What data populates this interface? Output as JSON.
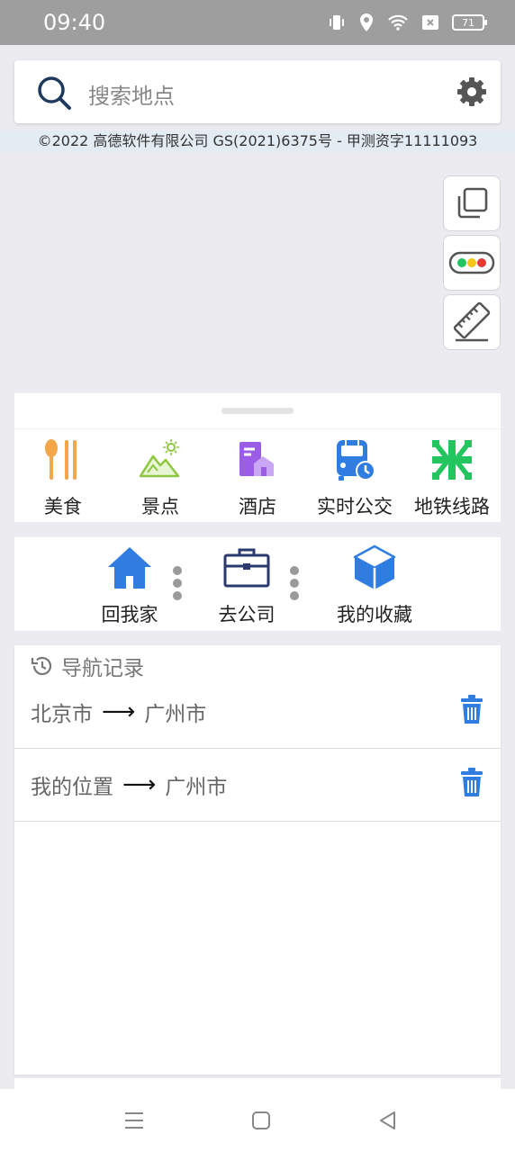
{
  "status_bar": {
    "time": "09:40",
    "battery": "71"
  },
  "search": {
    "placeholder": "搜索地点"
  },
  "copyright": "©2022 高德软件有限公司 GS(2021)6375号 - 甲测资字11111093",
  "categories": [
    {
      "label": "美食",
      "icon": "food-icon",
      "color": "#f4a64a"
    },
    {
      "label": "景点",
      "icon": "scenic-icon",
      "color": "#8dc63f"
    },
    {
      "label": "酒店",
      "icon": "hotel-icon",
      "color": "#9b5de5"
    },
    {
      "label": "实时公交",
      "icon": "bus-icon",
      "color": "#2f7de1"
    },
    {
      "label": "地铁线路",
      "icon": "metro-icon",
      "color": "#22c55e"
    }
  ],
  "quick_actions": [
    {
      "label": "回我家",
      "icon": "home-icon"
    },
    {
      "label": "去公司",
      "icon": "briefcase-icon"
    },
    {
      "label": "我的收藏",
      "icon": "box-icon"
    }
  ],
  "history": {
    "title": "导航记录",
    "items": [
      {
        "from": "北京市",
        "to": "广州市"
      },
      {
        "from": "我的位置",
        "to": "广州市"
      }
    ]
  },
  "colors": {
    "accent": "#2f7de1",
    "status_bg": "#9e9e9e"
  }
}
